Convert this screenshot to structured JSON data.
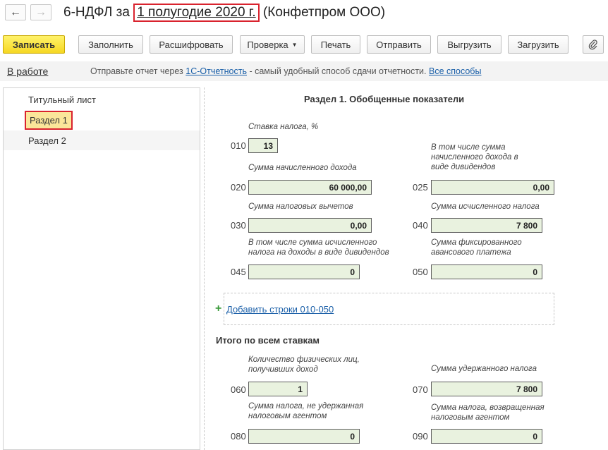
{
  "header": {
    "back_glyph": "←",
    "forward_glyph": "→",
    "title_prefix": "6-НДФЛ за ",
    "title_period": "1 полугодие 2020 г.",
    "title_suffix": " (Конфетпром ООО)"
  },
  "toolbar": {
    "save": "Записать",
    "fill": "Заполнить",
    "decode": "Расшифровать",
    "check": "Проверка",
    "print": "Печать",
    "send": "Отправить",
    "export": "Выгрузить",
    "import": "Загрузить",
    "attach_icon": "paperclip-icon"
  },
  "infobar": {
    "status": "В работе",
    "text1": "Отправьте отчет через ",
    "link1": "1С-Отчетность",
    "text2": " - самый удобный способ сдачи отчетности. ",
    "link2": "Все способы"
  },
  "nav": {
    "items": [
      "Титульный лист",
      "Раздел 1",
      "Раздел 2"
    ],
    "selected_index": 1
  },
  "form": {
    "section_title": "Раздел 1. Обобщенные показатели",
    "f010": {
      "code": "010",
      "label": "Ставка налога, %",
      "value": "13"
    },
    "f020": {
      "code": "020",
      "label": "Сумма начисленного дохода",
      "value": "60 000,00"
    },
    "f025": {
      "code": "025",
      "label": "В том числе сумма начисленного дохода в виде дивидендов",
      "value": "0,00"
    },
    "f030": {
      "code": "030",
      "label": "Сумма налоговых вычетов",
      "value": "0,00"
    },
    "f040": {
      "code": "040",
      "label": "Сумма исчисленного налога",
      "value": "7 800"
    },
    "f045": {
      "code": "045",
      "label": "В том числе сумма исчисленного налога на доходы в виде дивидендов",
      "value": "0"
    },
    "f050": {
      "code": "050",
      "label": "Сумма фиксированного авансового платежа",
      "value": "0"
    },
    "add_rows": "Добавить строки 010-050",
    "totals_title": "Итого по всем ставкам",
    "f060": {
      "code": "060",
      "label": "Количество физических лиц, получивших доход",
      "value": "1"
    },
    "f070": {
      "code": "070",
      "label": "Сумма удержанного налога",
      "value": "7 800"
    },
    "f080": {
      "code": "080",
      "label": "Сумма налога, не удержанная налоговым агентом",
      "value": "0"
    },
    "f090": {
      "code": "090",
      "label": "Сумма налога, возвращенная налоговым агентом",
      "value": "0"
    }
  }
}
